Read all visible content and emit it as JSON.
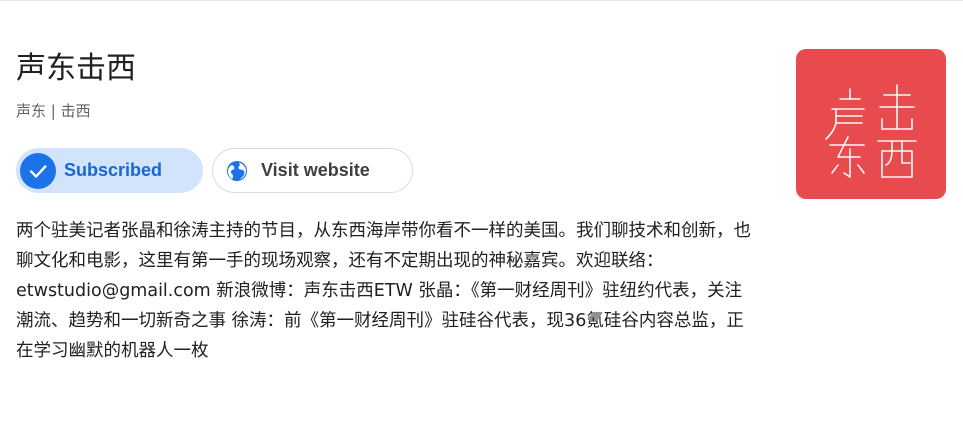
{
  "podcast": {
    "title": "声东击西",
    "subtitle": "声东 | 击西",
    "subscribe_label": "Subscribed",
    "visit_label": "Visit website",
    "description": "两个驻美记者张晶和徐涛主持的节目，从东西海岸带你看不一样的美国。我们聊技术和创新，也聊文化和电影，这里有第一手的现场观察，还有不定期出现的神秘嘉宾。欢迎联络：etwstudio@gmail.com 新浪微博：声东击西ETW 张晶：《第一财经周刊》驻纽约代表，关注潮流、趋势和一切新奇之事 徐涛：前《第一财经周刊》驻硅谷代表，现36氪硅谷内容总监，正在学习幽默的机器人一枚",
    "logo_text": "声东击西"
  },
  "icons": {
    "check": "check-icon",
    "globe": "globe-icon"
  },
  "colors": {
    "accent": "#1a73e8",
    "subscribed_bg": "#d2e3fc",
    "logo_bg": "#e84b4d"
  }
}
